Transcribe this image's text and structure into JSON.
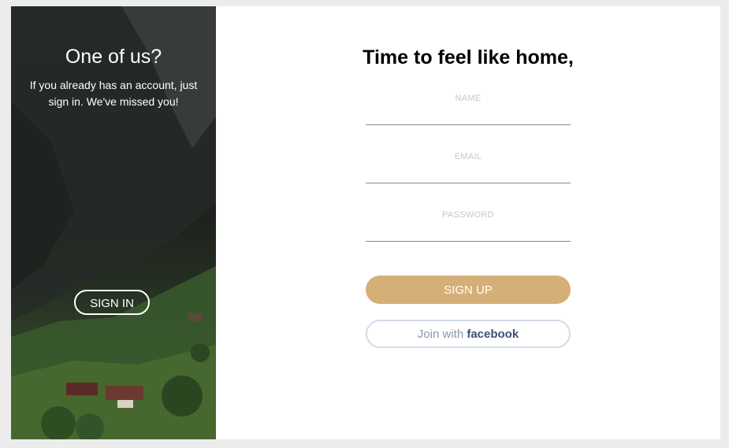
{
  "side_panel": {
    "title": "One of us?",
    "description": "If you already has an account, just sign in. We've missed you!",
    "button_label": "SIGN IN"
  },
  "form": {
    "title": "Time to feel like home,",
    "fields": [
      {
        "label": "NAME",
        "value": ""
      },
      {
        "label": "EMAIL",
        "value": ""
      },
      {
        "label": "PASSWORD",
        "value": ""
      }
    ],
    "signup_label": "SIGN UP",
    "facebook": {
      "prefix": "Join with ",
      "brand": "facebook"
    }
  },
  "colors": {
    "accent": "#d4af78",
    "facebook_border": "#d3dae8",
    "facebook_text": "#3b5178",
    "page_background": "#ececec"
  }
}
